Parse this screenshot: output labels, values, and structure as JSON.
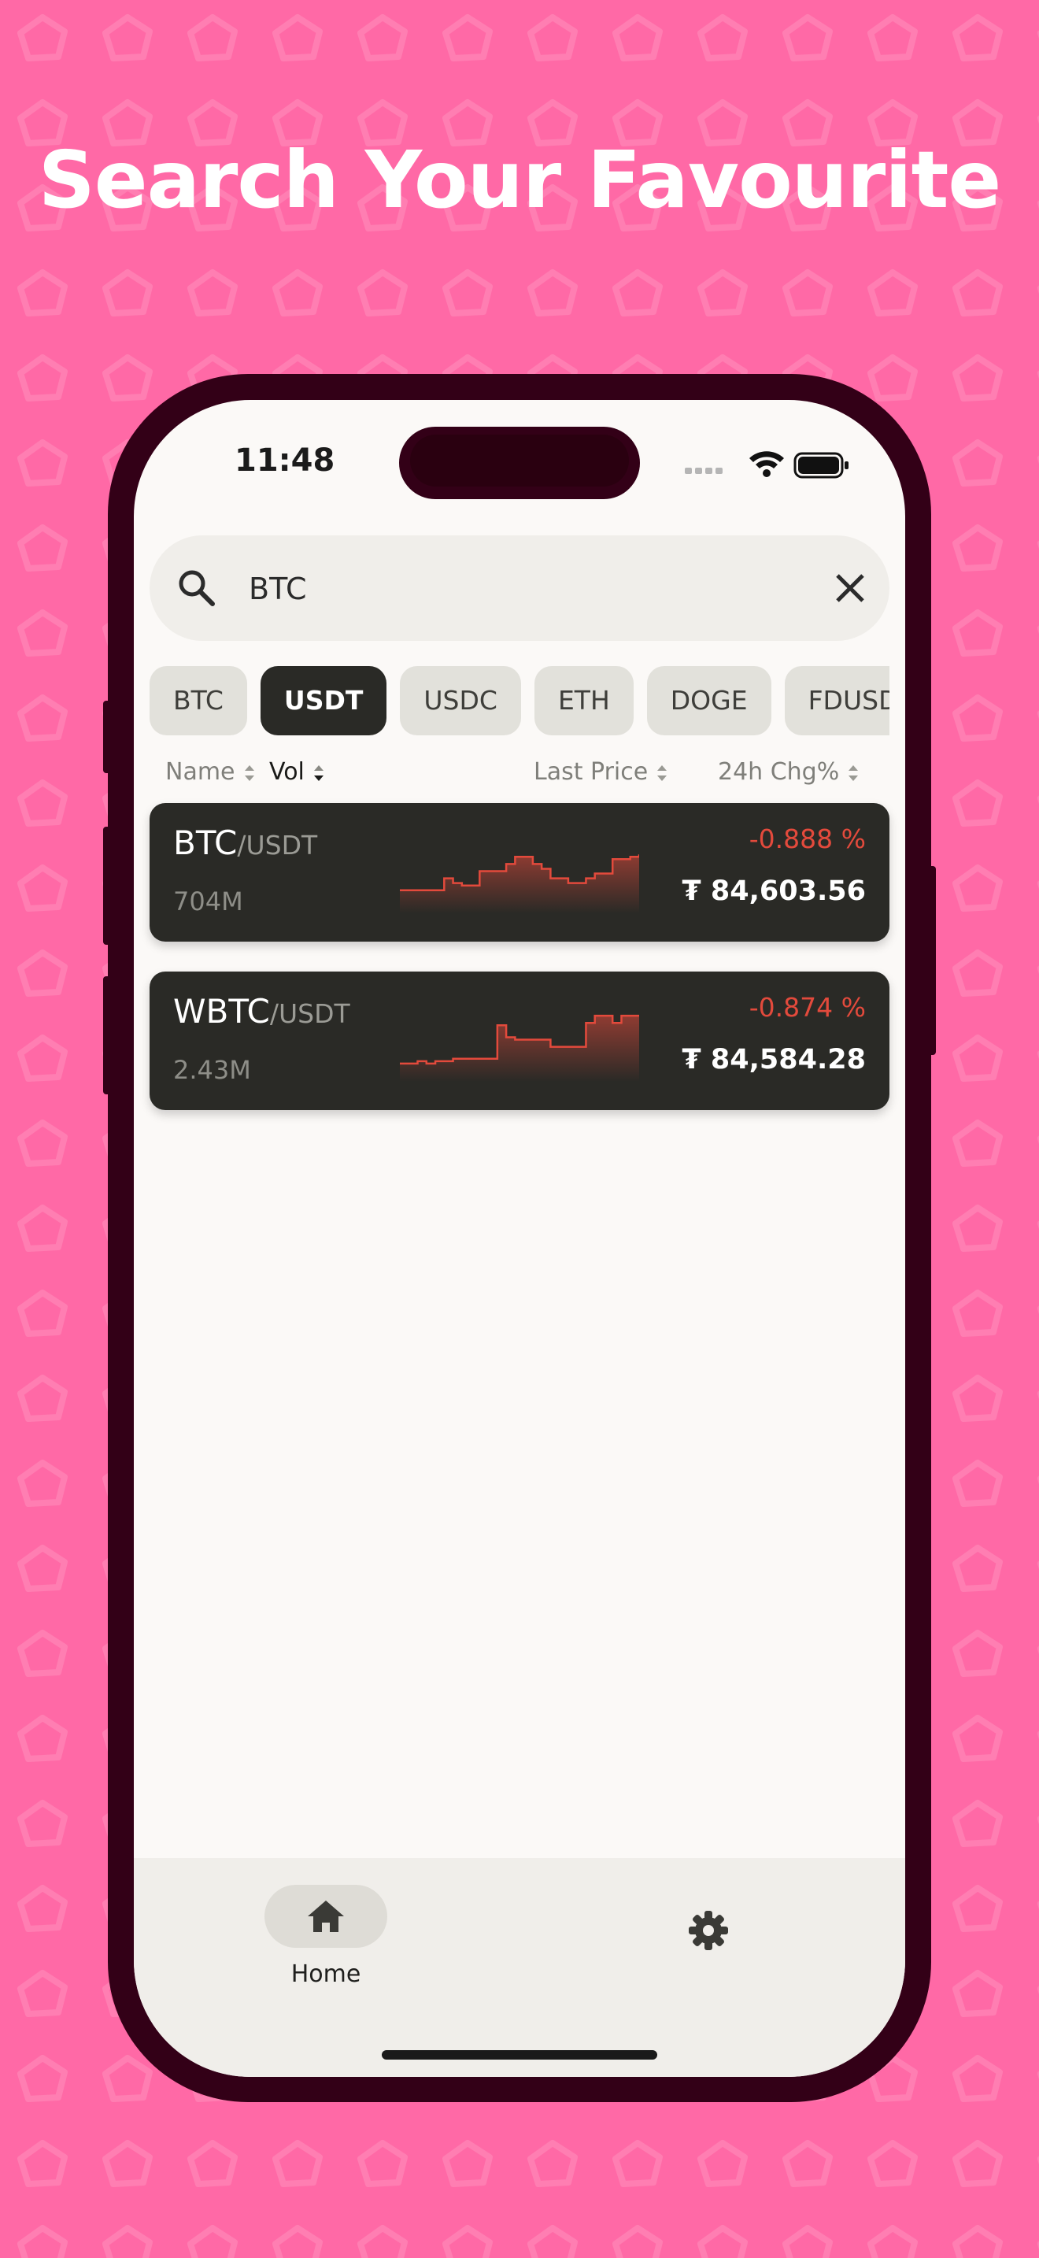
{
  "headline": "Search Your Favourite",
  "status_bar": {
    "time": "11:48"
  },
  "search": {
    "value": "BTC"
  },
  "quote_tabs": [
    {
      "label": "BTC",
      "active": false
    },
    {
      "label": "USDT",
      "active": true
    },
    {
      "label": "USDC",
      "active": false
    },
    {
      "label": "ETH",
      "active": false
    },
    {
      "label": "DOGE",
      "active": false
    },
    {
      "label": "FDUSD",
      "active": false
    }
  ],
  "sort_headers": {
    "name": "Name",
    "vol": "Vol",
    "last_price": "Last Price",
    "change": "24h Chg%"
  },
  "pairs": [
    {
      "base": "BTC",
      "quote": "/USDT",
      "volume": "704M",
      "change": "-0.888 %",
      "price": "₮ 84,603.56",
      "sparkline": [
        40,
        40,
        40,
        40,
        40,
        30,
        34,
        36,
        36,
        24,
        24,
        24,
        18,
        12,
        12,
        18,
        22,
        30,
        30,
        34,
        34,
        30,
        26,
        26,
        14,
        14,
        12,
        10
      ]
    },
    {
      "base": "WBTC",
      "quote": "/USDT",
      "volume": "2.43M",
      "change": "-0.874 %",
      "price": "₮ 84,584.28",
      "sparkline": [
        44,
        44,
        42,
        44,
        42,
        42,
        40,
        40,
        40,
        40,
        40,
        12,
        22,
        24,
        24,
        24,
        24,
        30,
        30,
        30,
        30,
        10,
        4,
        4,
        10,
        4,
        4,
        4
      ]
    }
  ],
  "nav": {
    "home_label": "Home"
  },
  "colors": {
    "background": "#ff69a6",
    "card": "#2a2a26",
    "negative": "#e34a3c",
    "frame": "#330017"
  }
}
